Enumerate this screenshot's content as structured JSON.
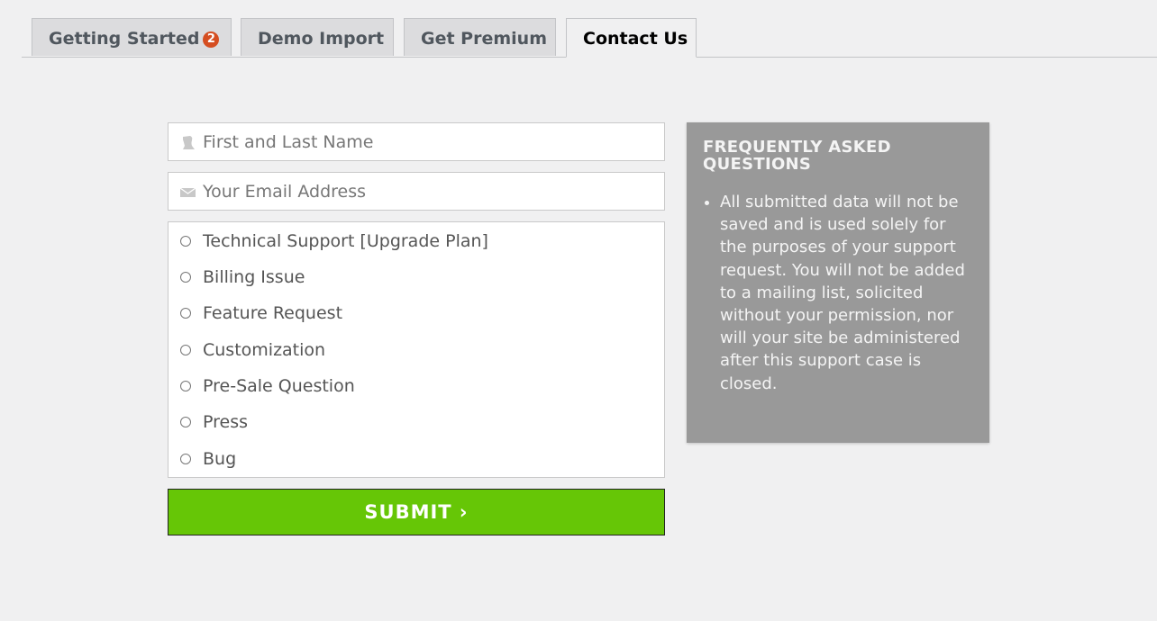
{
  "tabs": [
    {
      "label": "Getting Started",
      "badge": "2"
    },
    {
      "label": "Demo Import"
    },
    {
      "label": "Get Premium"
    },
    {
      "label": "Contact Us"
    }
  ],
  "form": {
    "name_placeholder": "First and Last Name",
    "email_placeholder": "Your Email Address",
    "topics": [
      "Technical Support [Upgrade Plan]",
      "Billing Issue",
      "Feature Request",
      "Customization",
      "Pre-Sale Question",
      "Press",
      "Bug"
    ],
    "submit_label": "SUBMIT ›",
    "submit_color": "#66c606"
  },
  "faq": {
    "title": "FREQUENTLY ASKED QUESTIONS",
    "items": [
      "All submitted data will not be saved and is used solely for the purposes of your support request. You will not be added to a mailing list, solicited without your permission, nor will your site be administered after this support case is closed."
    ]
  },
  "colors": {
    "badge": "#d54e21",
    "faq_background": "#999999"
  }
}
